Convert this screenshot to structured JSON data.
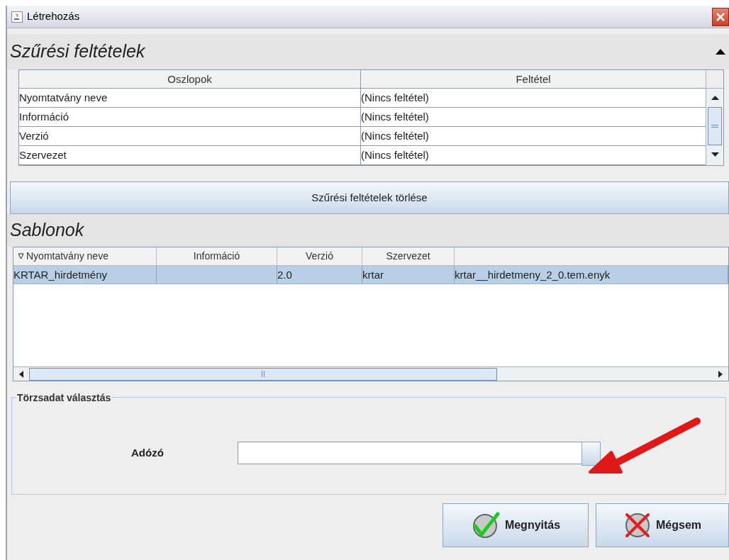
{
  "window": {
    "title": "Létrehozás"
  },
  "filter_section": {
    "title": "Szűrési feltételek",
    "expanded": true,
    "table": {
      "columns": [
        "Oszlopok",
        "Feltétel"
      ],
      "rows": [
        [
          "Nyomtatvány neve",
          "(Nincs feltétel)"
        ],
        [
          "Információ",
          "(Nincs feltétel)"
        ],
        [
          "Verzió",
          "(Nincs feltétel)"
        ],
        [
          "Szervezet",
          "(Nincs feltétel)"
        ]
      ]
    }
  },
  "clear_button": "Szűrési feltételek törlése",
  "templates": {
    "title": "Sablonok",
    "columns": [
      {
        "label": "Nyomtatvány neve",
        "sorted": true
      },
      {
        "label": "Információ",
        "sorted": false
      },
      {
        "label": "Verzió",
        "sorted": false
      },
      {
        "label": "Szervezet",
        "sorted": false
      }
    ],
    "rows": [
      {
        "cells": [
          "KRTAR_hirdetmény",
          "",
          "2.0",
          "krtar",
          "krtar__hirdetmeny_2_0.tem.enyk"
        ],
        "selected": true
      }
    ]
  },
  "master_data": {
    "legend": "Törzsadat választás",
    "field_label": "Adózó"
  },
  "buttons": [
    {
      "label": "Megnyitás",
      "kind": "ok"
    },
    {
      "label": "Mégsem",
      "kind": "cancel"
    }
  ]
}
